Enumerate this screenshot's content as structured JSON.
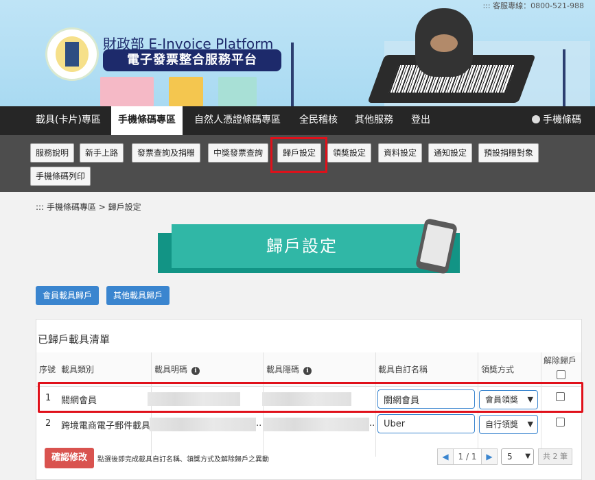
{
  "header": {
    "hotline": "::: 客服專線：0800-521-988",
    "brand_line1": "財政部 E-Invoice Platform",
    "brand_line2": "電子發票整合服務平台"
  },
  "main_nav": {
    "items": [
      {
        "label": "載具(卡片)專區"
      },
      {
        "label": "手機條碼專區",
        "active": true
      },
      {
        "label": "自然人憑證條碼專區"
      },
      {
        "label": "全民稽核"
      },
      {
        "label": "其他服務"
      },
      {
        "label": "登出"
      }
    ],
    "user_label": "手機條碼"
  },
  "sub_nav": {
    "items": [
      {
        "label": "服務說明"
      },
      {
        "label": "新手上路"
      },
      {
        "label": "發票查詢及捐贈"
      },
      {
        "label": "中獎發票查詢"
      },
      {
        "label": "歸戶設定",
        "highlighted": true
      },
      {
        "label": "領獎設定"
      },
      {
        "label": "資料設定"
      },
      {
        "label": "通知設定"
      },
      {
        "label": "預設捐贈對象"
      },
      {
        "label": "手機條碼列印"
      }
    ]
  },
  "breadcrumb": "::: 手機條碼專區 > 歸戶設定",
  "page_title": "歸戶設定",
  "carrier_buttons": {
    "member": "會員載具歸戶",
    "other": "其他載具歸戶"
  },
  "panel": {
    "title": "已歸戶載具清單",
    "headers": {
      "index": "序號",
      "type": "載具類別",
      "visible_code": "載具明碼",
      "hidden_code": "載具隱碼",
      "custom_name": "載具自訂名稱",
      "prize_method": "領獎方式",
      "unlink": "解除歸戶"
    },
    "rows": [
      {
        "index": "1",
        "type": "關網會員",
        "custom_name": "關網會員",
        "prize_method": "會員領獎"
      },
      {
        "index": "2",
        "type": "跨境電商電子郵件載具",
        "custom_name": "Uber",
        "prize_method": "自行領獎"
      }
    ],
    "truncated_suffix": "..",
    "confirm_button": "確認修改",
    "confirm_note": "點選後即完成載具自訂名稱、領獎方式及解除歸戶之異動",
    "pager": {
      "page_text": "1 / 1",
      "page_size": "5",
      "total": "共 2 筆"
    }
  },
  "colors": {
    "nav_bg": "#262626",
    "subnav_bg": "#4d4d4d",
    "accent_blue": "#3a85cf",
    "title_teal": "#30b7a6",
    "confirm_red": "#d9534f",
    "highlight_red": "#e0101a"
  }
}
